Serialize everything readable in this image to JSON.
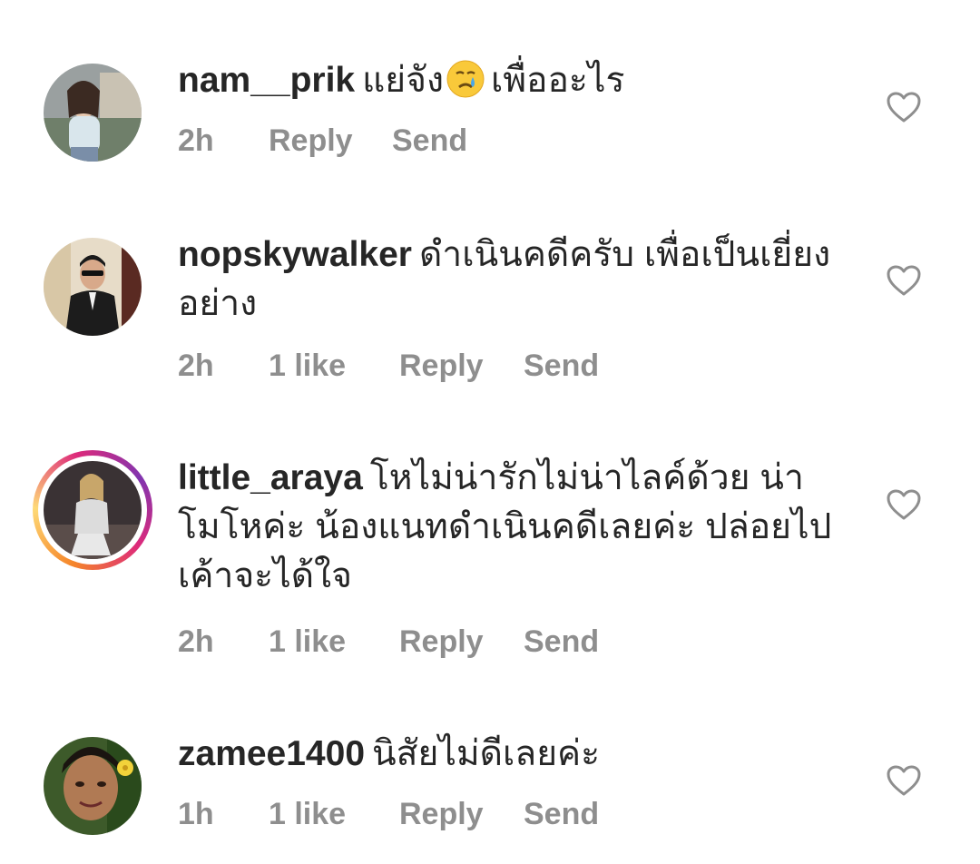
{
  "comments": [
    {
      "username": "nam__prik",
      "text_before": "แย่จัง",
      "emoji": "crying-face-emoji",
      "text_after": "เพื่ออะไร",
      "time": "2h",
      "likes": "",
      "reply": "Reply",
      "send": "Send"
    },
    {
      "username": "nopskywalker",
      "text": "ดำเนินคดีครับ เพื่อเป็นเยี่ยงอย่าง",
      "time": "2h",
      "likes": "1 like",
      "reply": "Reply",
      "send": "Send"
    },
    {
      "username": "little_araya",
      "text": "โหไม่น่ารักไม่น่าไลค์ด้วย น่าโมโหค่ะ น้องแนทดำเนินคดีเลยค่ะ ปล่อยไปเค้าจะได้ใจ",
      "time": "2h",
      "likes": "1 like",
      "reply": "Reply",
      "send": "Send"
    },
    {
      "username": "zamee1400",
      "text": "นิสัยไม่ดีเลยค่ะ",
      "time": "1h",
      "likes": "1 like",
      "reply": "Reply",
      "send": "Send"
    }
  ],
  "icons": {
    "like": "heart-outline-icon"
  },
  "colors": {
    "text": "#262626",
    "meta": "#8e8e8e",
    "heart": "#8e8e8e"
  }
}
